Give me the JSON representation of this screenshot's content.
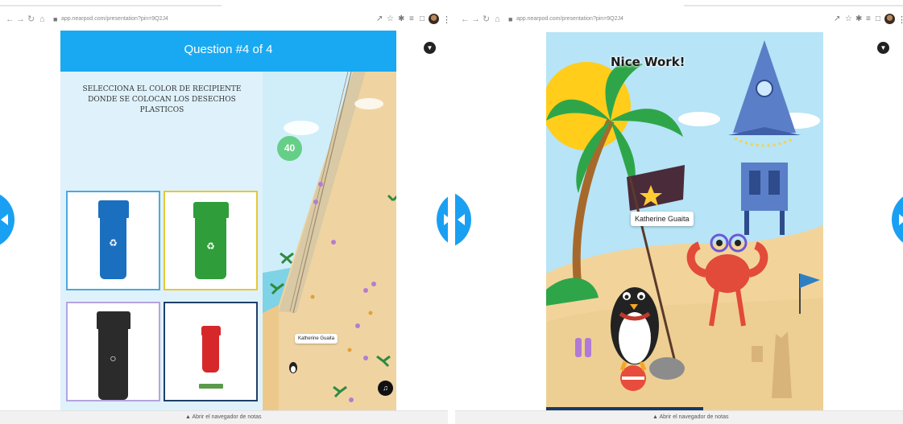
{
  "left_window": {
    "address_bar": {
      "url": "app.nearpod.com/presentation?pin=9Q2J4"
    },
    "quiz": {
      "header": "Question #4 of 4",
      "question": "SELECCIONA EL COLOR DE RECIPIENTE DONDE SE COLOCAN LOS DESECHOS PLASTICOS",
      "answers": [
        {
          "color_name": "blue",
          "border": "#4aa9e0",
          "bin": "#1b6fbf"
        },
        {
          "color_name": "green",
          "border": "#e6c739",
          "bin": "#2f9e3a"
        },
        {
          "color_name": "black",
          "border": "#b7a3de",
          "bin": "#2b2b2b"
        },
        {
          "color_name": "red",
          "border": "#1f3f68",
          "bin": "#d6282b"
        }
      ],
      "race": {
        "score": "40",
        "player": "Katherine Guaita"
      }
    },
    "footer": "▲ Abrir el navegador de notas"
  },
  "right_window": {
    "address_bar": {
      "url": "app.nearpod.com/presentation?pin=9Q2J4"
    },
    "results": {
      "title": "Nice Work!",
      "player": "Katherine Guaita"
    },
    "footer": "▲ Abrir el navegador de notas"
  },
  "colors": {
    "accent": "#18a9f2",
    "nav_arrow": "#1aa0f2",
    "panel": "#dff2fb"
  },
  "icons": [
    "back-icon",
    "forward-icon",
    "reload-icon",
    "home-icon",
    "lock-icon",
    "share-icon",
    "star-icon",
    "extensions-icon",
    "playlist-icon",
    "sidebar-icon",
    "avatar",
    "menu-icon",
    "chevron-down-icon",
    "sound-icon"
  ]
}
